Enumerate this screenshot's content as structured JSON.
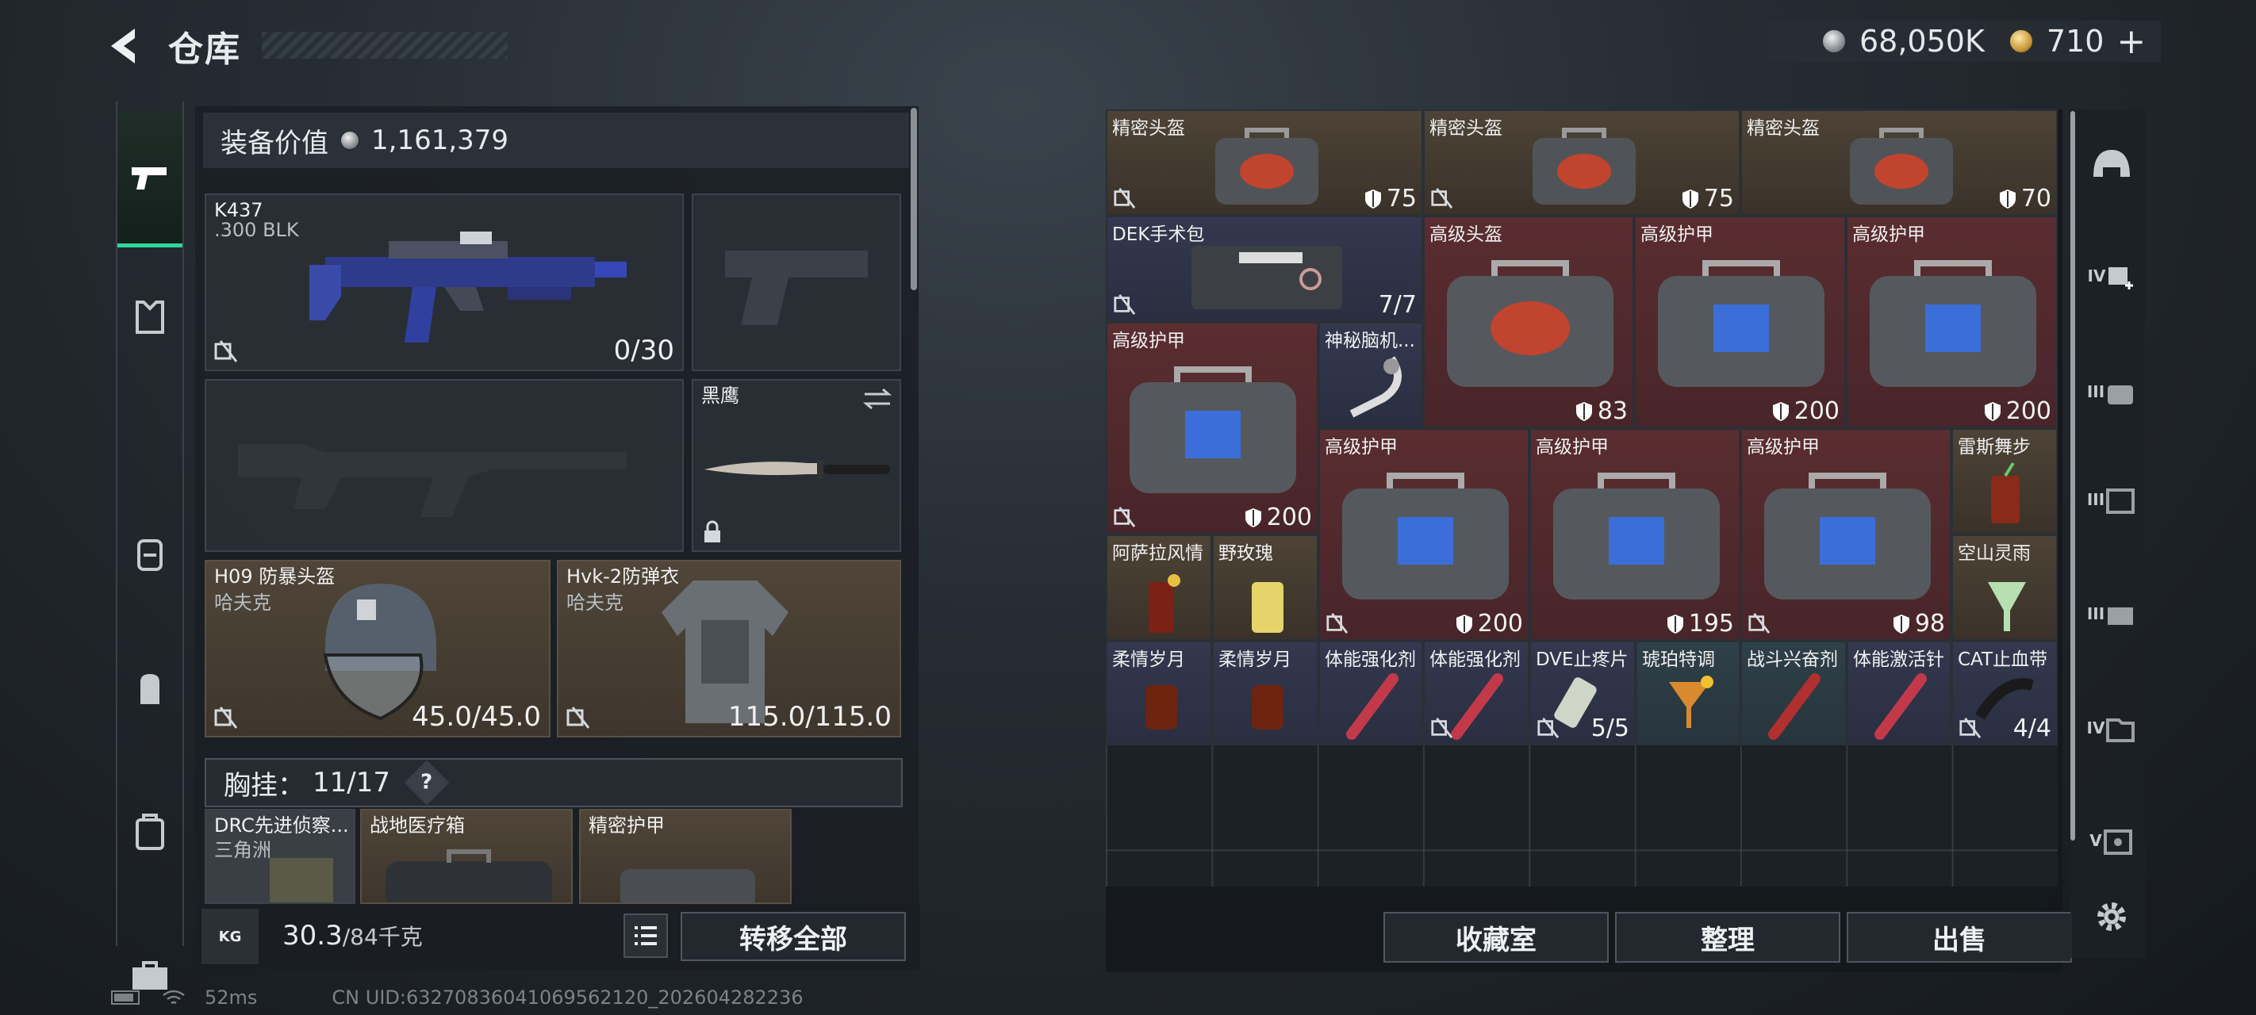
{
  "header": {
    "title": "仓库",
    "currency_silver": "68,050K",
    "currency_gold": "710",
    "plus": "+"
  },
  "left": {
    "value_label": "装备价值",
    "value": "1,161,379",
    "primary": {
      "name": "K437",
      "caliber": ".300 BLK",
      "ammo": "0/30"
    },
    "melee": {
      "name": "黑鹰"
    },
    "helmet": {
      "name": "H09 防暴头盔",
      "brand": "哈夫克",
      "durability": "45.0/45.0"
    },
    "armor": {
      "name": "Hvk-2防弹衣",
      "brand": "哈夫克",
      "durability": "115.0/115.0"
    },
    "chest": {
      "label": "胸挂：",
      "count": "11/17",
      "help": "?"
    },
    "slots": [
      {
        "name": "DRC先进侦察...",
        "sub": "三角洲"
      },
      {
        "name": "战地医疗箱",
        "sub": ""
      },
      {
        "name": "精密护甲",
        "sub": ""
      }
    ],
    "weight": {
      "value": "30.3",
      "max": "/84千克"
    },
    "kg_icon": "KG",
    "transfer_all": "转移全部"
  },
  "grid_items": [
    {
      "name": "精密头盔",
      "val": "75"
    },
    {
      "name": "精密头盔",
      "val": "75"
    },
    {
      "name": "精密头盔",
      "val": "70"
    },
    {
      "name": "DEK手术包",
      "val": "7/7"
    },
    {
      "name": "高级头盔",
      "val": "83"
    },
    {
      "name": "高级护甲",
      "val": "200"
    },
    {
      "name": "高级护甲",
      "val": "200"
    },
    {
      "name": "高级护甲",
      "val": "200"
    },
    {
      "name": "神秘脑机...",
      "val": ""
    },
    {
      "name": "高级护甲",
      "val": "200"
    },
    {
      "name": "高级护甲",
      "val": "195"
    },
    {
      "name": "高级护甲",
      "val": "98"
    },
    {
      "name": "雷斯舞步",
      "val": ""
    },
    {
      "name": "阿萨拉风情",
      "val": ""
    },
    {
      "name": "野玫瑰",
      "val": ""
    },
    {
      "name": "空山灵雨",
      "val": ""
    },
    {
      "name": "柔情岁月",
      "val": ""
    },
    {
      "name": "柔情岁月",
      "val": ""
    },
    {
      "name": "体能强化剂",
      "val": ""
    },
    {
      "name": "体能强化剂",
      "val": ""
    },
    {
      "name": "DVE止疼片",
      "val": "5/5"
    },
    {
      "name": "琥珀特调",
      "val": ""
    },
    {
      "name": "战斗兴奋剂",
      "val": ""
    },
    {
      "name": "体能激活针",
      "val": ""
    },
    {
      "name": "CAT止血带",
      "val": "4/4"
    }
  ],
  "buttons": {
    "collection": "收藏室",
    "sort": "整理",
    "sell": "出售"
  },
  "rail": [
    "IV",
    "III",
    "III",
    "III",
    "IV",
    "V"
  ],
  "status": {
    "ping": "52ms",
    "uid": "CN UID:63270836041069562120_202604282236"
  }
}
